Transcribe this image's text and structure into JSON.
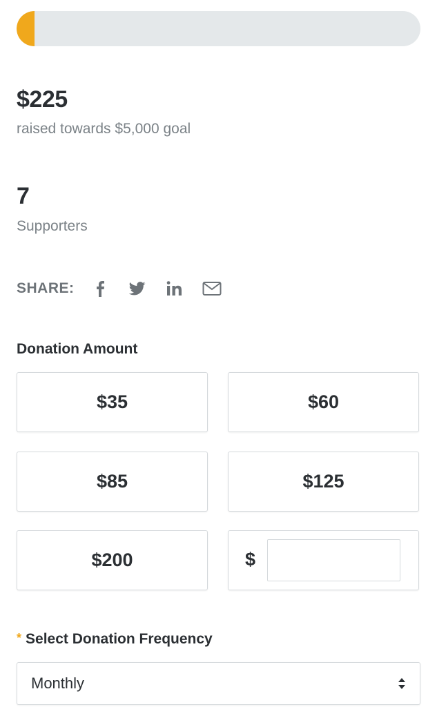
{
  "progress": {
    "fraction": 0.045,
    "fill_color": "#f0a81c",
    "track_color": "#e4e8ea"
  },
  "raised": {
    "amount": "$225",
    "label": "raised towards $5,000 goal"
  },
  "supporters": {
    "count": "7",
    "label": "Supporters"
  },
  "share": {
    "label": "SHARE:",
    "icons": [
      "facebook-icon",
      "twitter-icon",
      "linkedin-icon",
      "email-icon"
    ]
  },
  "donation_amount": {
    "title": "Donation Amount",
    "options": [
      "$35",
      "$60",
      "$85",
      "$125",
      "$200"
    ],
    "custom_symbol": "$",
    "custom_value": ""
  },
  "frequency": {
    "required_mark": "*",
    "title": "Select Donation Frequency",
    "selected": "Monthly"
  },
  "colors": {
    "accent": "#f0a81c",
    "text_dark": "#2b2f33",
    "text_muted": "#7b8287",
    "border": "#d5d9dc"
  }
}
